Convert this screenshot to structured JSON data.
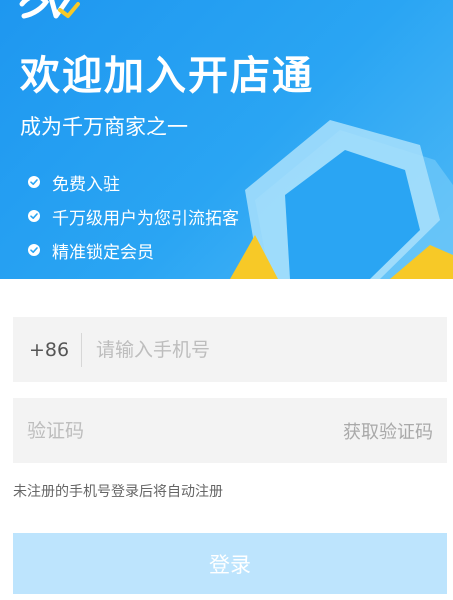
{
  "banner": {
    "title": "欢迎加入开店通",
    "subtitle": "成为千万商家之一",
    "features": [
      {
        "label": "免费入驻",
        "icon": "check-circle-icon"
      },
      {
        "label": "千万级用户为您引流拓客",
        "icon": "check-circle-icon"
      },
      {
        "label": "精准锁定会员",
        "icon": "check-circle-icon"
      }
    ],
    "colors": {
      "background_start": "#1e97f0",
      "background_end": "#4fb9f6",
      "accent_yellow": "#f7c927"
    }
  },
  "form": {
    "country_code": "+86",
    "phone_placeholder": "请输入手机号",
    "code_placeholder": "验证码",
    "get_code_label": "获取验证码",
    "auto_register_note": "未注册的手机号登录后将自动注册",
    "login_label": "登录",
    "login_button_color": "#bde4fd"
  }
}
